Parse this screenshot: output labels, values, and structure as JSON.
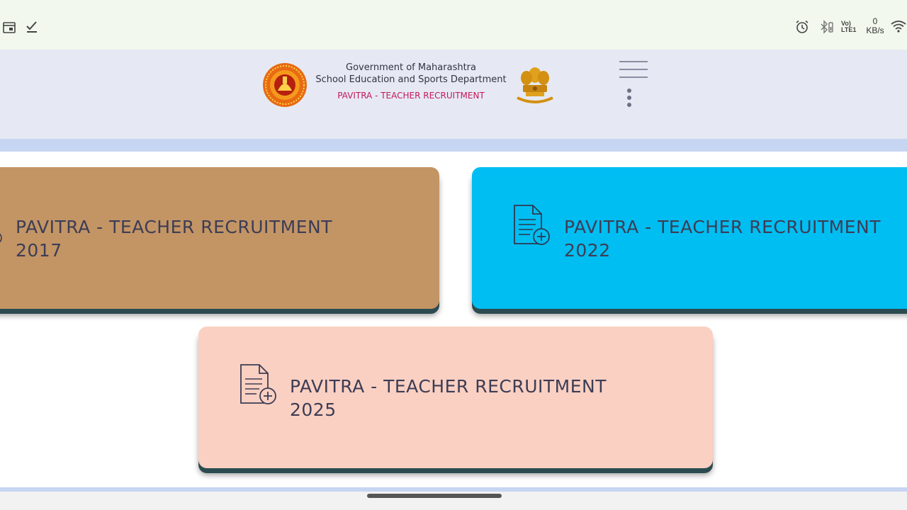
{
  "status_bar": {
    "left_icons": [
      "calendar-icon",
      "checkmark-icon"
    ],
    "right_icons": [
      "alarm-icon",
      "bluetooth-icon",
      "volte-icon",
      "wifi-icon"
    ],
    "volte_line1": "Vo)",
    "volte_line2": "LTE1",
    "net_speed_value": "0",
    "net_speed_unit": "KB/s"
  },
  "header": {
    "line1": "Government of Maharashtra",
    "line2": "School Education and Sports Department",
    "line3": "PAVITRA - TEACHER RECRUITMENT",
    "left_logo": "maharashtra-seal-icon",
    "right_logo": "ashoka-emblem-icon",
    "accent_color": "#c2185b"
  },
  "cards": [
    {
      "title": "PAVITRA - TEACHER RECRUITMENT",
      "year": "2017",
      "color": "#c39565"
    },
    {
      "title": "PAVITRA - TEACHER RECRUITMENT",
      "year": "2022",
      "color": "#00bef2"
    },
    {
      "title": "PAVITRA - TEACHER RECRUITMENT",
      "year": "2025",
      "color": "#fad0c2"
    }
  ]
}
